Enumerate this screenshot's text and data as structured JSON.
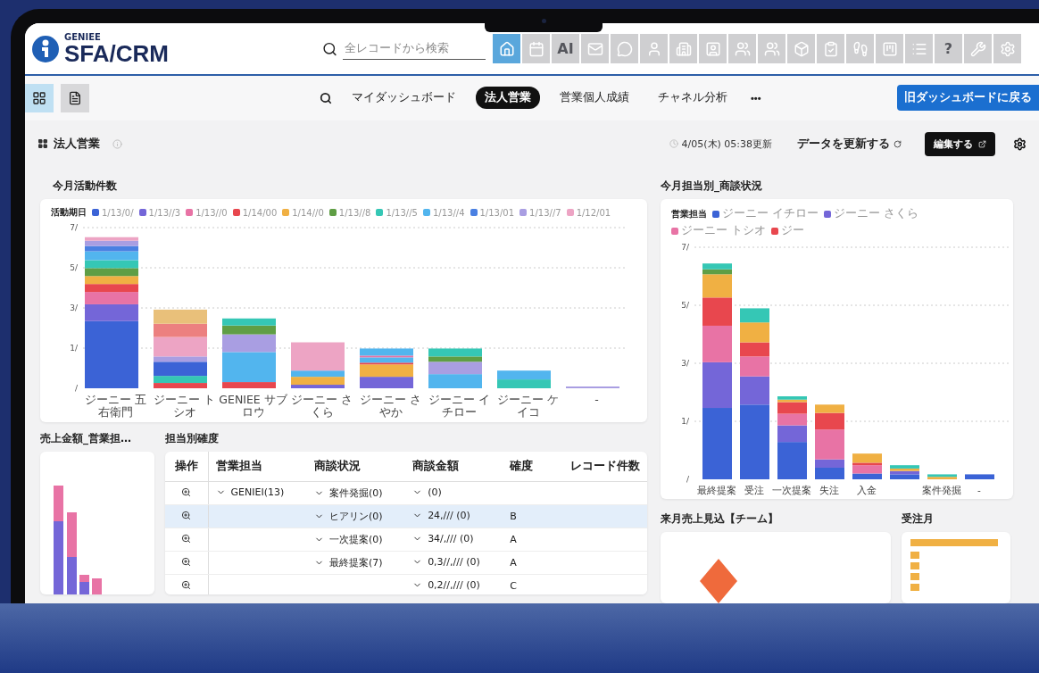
{
  "header": {
    "brand_small": "GENIEE",
    "brand": "SFA/CRM",
    "search": {
      "placeholder": "全レコードから検索"
    },
    "toolbar": [
      {
        "kind": "icon",
        "selected": true
      },
      {
        "kind": "icon",
        "selected": false
      },
      {
        "kind": "text",
        "label": "AI",
        "selected": false
      },
      {
        "kind": "icon",
        "selected": false
      },
      {
        "kind": "icon",
        "selected": false
      },
      {
        "kind": "icon",
        "selected": false
      },
      {
        "kind": "icon",
        "selected": false
      },
      {
        "kind": "icon",
        "selected": false
      },
      {
        "kind": "icon",
        "selected": false
      },
      {
        "kind": "icon",
        "selected": false
      },
      {
        "kind": "icon",
        "selected": false
      },
      {
        "kind": "icon",
        "selected": false
      },
      {
        "kind": "icon",
        "selected": false
      },
      {
        "kind": "icon",
        "selected": false
      },
      {
        "kind": "icon",
        "selected": false
      },
      {
        "kind": "text",
        "label": "?",
        "selected": false
      },
      {
        "kind": "icon",
        "selected": false
      },
      {
        "kind": "icon",
        "selected": false
      }
    ]
  },
  "nav": {
    "views": [
      {
        "selected": true
      },
      {
        "selected": false
      }
    ],
    "tabs": [
      {
        "label": "マイダッシュボード",
        "selected": false
      },
      {
        "label": "法人営業",
        "selected": true
      },
      {
        "label": "営業個人成績",
        "selected": false
      },
      {
        "label": "チャネル分析",
        "selected": false
      }
    ],
    "more": "•••",
    "back_button": "旧ダッシュボードに戻る"
  },
  "dashboard": {
    "title": "法人営業",
    "updated": "4/05(木) 05:38更新",
    "refresh": "データを更新する",
    "edit": "編集する"
  },
  "activity_chart": {
    "title": "今月活動件数",
    "legend_title": "活動期日",
    "legend": [
      {
        "label": "1/13/0/",
        "color": "#3b63d6"
      },
      {
        "label": "1/13//3",
        "color": "#7466d8"
      },
      {
        "label": "1/13//0",
        "color": "#e873a5"
      },
      {
        "label": "1/14/00",
        "color": "#e8474e"
      },
      {
        "label": "1/14//0",
        "color": "#f0b043"
      },
      {
        "label": "1/13//8",
        "color": "#5f9e45"
      },
      {
        "label": "1/13//5",
        "color": "#35c7b5"
      },
      {
        "label": "1/13//4",
        "color": "#52b5ee"
      },
      {
        "label": "1/13/01",
        "color": "#4a80e2"
      },
      {
        "label": "1/13//7",
        "color": "#a99ee2"
      },
      {
        "label": "1/12/01",
        "color": "#eda4c4"
      }
    ],
    "y_labels": [
      "7/",
      "5/",
      "3/",
      "1/",
      "/"
    ],
    "categories": [
      "ジーニー 五右衛門",
      "ジーニー トシオ",
      "GENIEE サブロウ",
      "ジーニー さくら",
      "ジーニー さやか",
      "ジーニー イチロー",
      "ジーニー ケイコ",
      "-"
    ]
  },
  "deal_chart": {
    "title": "今月担当別_商談状況",
    "legend_title": "営業担当",
    "legend": [
      {
        "label": "ジーニー イチロー",
        "color": "#3b63d6"
      },
      {
        "label": "ジーニー さくら",
        "color": "#7466d8"
      },
      {
        "label": "ジーニー トシオ",
        "color": "#e873a5"
      },
      {
        "label": "ジー",
        "color": "#e8474e"
      }
    ],
    "y_labels": [
      "7/",
      "5/",
      "3/",
      "1/",
      "/"
    ],
    "categories": [
      "最終提案",
      "受注",
      "一次提案",
      "失注",
      "入金",
      "案件発掘",
      "-"
    ]
  },
  "sales_panel": {
    "title": "売上金額_営業担…"
  },
  "probability_table": {
    "title": "担当別確度",
    "columns": [
      "操作",
      "営業担当",
      "商談状況",
      "商談金額",
      "確度",
      "レコード件数"
    ],
    "rows": [
      {
        "selected": false,
        "owner": {
          "text": "GENIEI(13)",
          "expanded": true
        },
        "status": {
          "text": "案件発掘(0)",
          "expanded": true
        },
        "amount": {
          "text": "(0)",
          "expanded": true
        }
      },
      {
        "selected": true,
        "status": {
          "text": "ヒアリン(0)",
          "expanded": true
        },
        "amount": {
          "text": "24,/// (0)",
          "expanded": true
        },
        "grade": "B"
      },
      {
        "selected": false,
        "status": {
          "text": "一次提案(0)",
          "expanded": true
        },
        "amount": {
          "text": "34/,/// (0)",
          "expanded": true
        },
        "grade": "A"
      },
      {
        "selected": false,
        "status": {
          "text": "最終提案(7)",
          "expanded": true
        },
        "amount": {
          "text": "0,3//,/// (0)",
          "expanded": true
        },
        "grade": "A"
      },
      {
        "selected": false,
        "amount": {
          "text": "0,2//,/// (0)",
          "expanded": true
        },
        "grade": "C"
      }
    ]
  },
  "forecast_panel": {
    "title": "来月売上見込【チーム】"
  },
  "order_month_panel": {
    "title": "受注月"
  }
}
